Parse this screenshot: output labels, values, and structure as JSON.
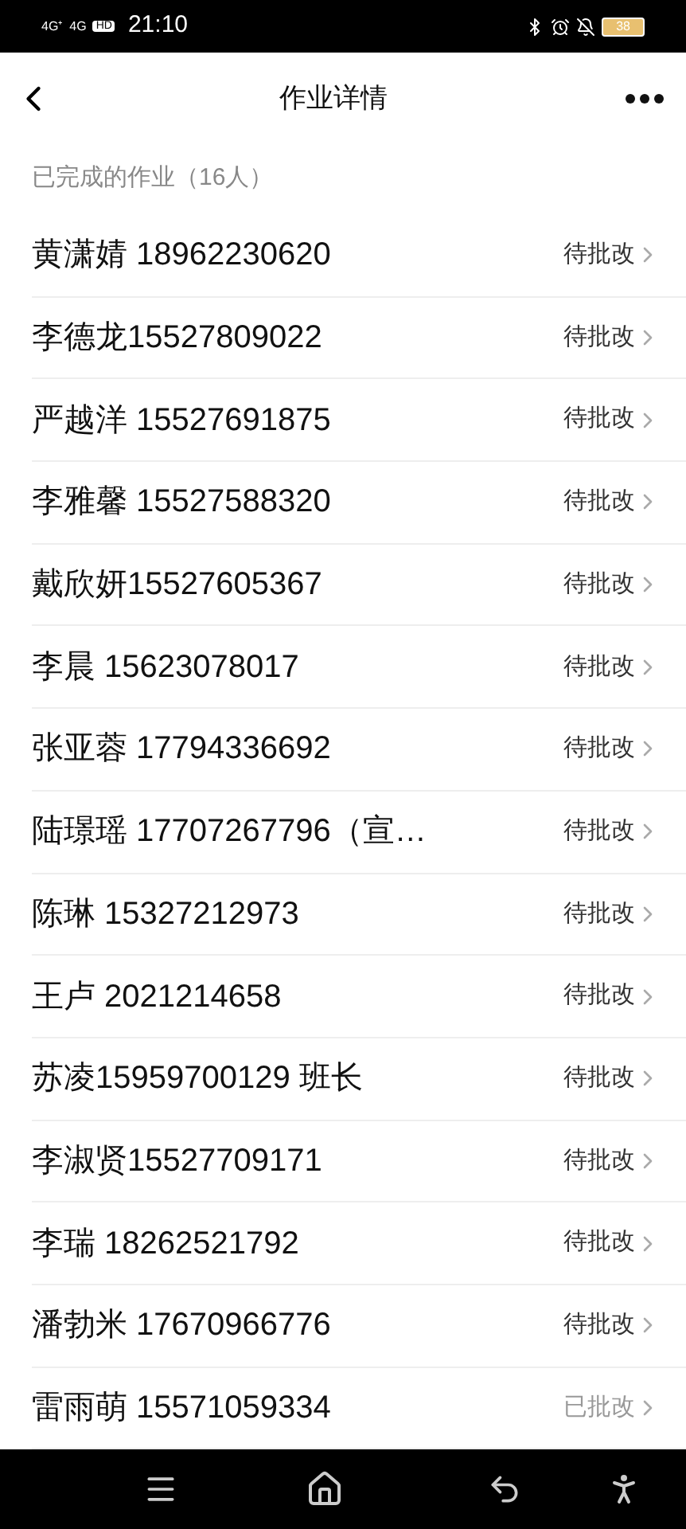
{
  "status_bar": {
    "signal_1": "4G⁺",
    "signal_2": "4G",
    "hd": "HD",
    "time": "21:10",
    "battery": "38"
  },
  "header": {
    "title": "作业详情"
  },
  "section": {
    "title": "已完成的作业（16人）"
  },
  "students": [
    {
      "name": "黄潇婧 18962230620",
      "status": "待批改",
      "graded": false
    },
    {
      "name": "李德龙15527809022",
      "status": "待批改",
      "graded": false
    },
    {
      "name": "严越洋 15527691875",
      "status": "待批改",
      "graded": false
    },
    {
      "name": "李雅馨 15527588320",
      "status": "待批改",
      "graded": false
    },
    {
      "name": "戴欣妍15527605367",
      "status": "待批改",
      "graded": false
    },
    {
      "name": "李晨 15623078017",
      "status": "待批改",
      "graded": false
    },
    {
      "name": "张亚蓉 17794336692",
      "status": "待批改",
      "graded": false
    },
    {
      "name": "陆璟瑶 17707267796（宣…",
      "status": "待批改",
      "graded": false
    },
    {
      "name": "陈琳 15327212973",
      "status": "待批改",
      "graded": false
    },
    {
      "name": "王卢 2021214658",
      "status": "待批改",
      "graded": false
    },
    {
      "name": "苏凌15959700129 班长",
      "status": "待批改",
      "graded": false
    },
    {
      "name": "李淑贤15527709171",
      "status": "待批改",
      "graded": false
    },
    {
      "name": "李瑞 18262521792",
      "status": "待批改",
      "graded": false
    },
    {
      "name": "潘勃米 17670966776",
      "status": "待批改",
      "graded": false
    },
    {
      "name": "雷雨萌 15571059334",
      "status": "已批改",
      "graded": true
    }
  ]
}
